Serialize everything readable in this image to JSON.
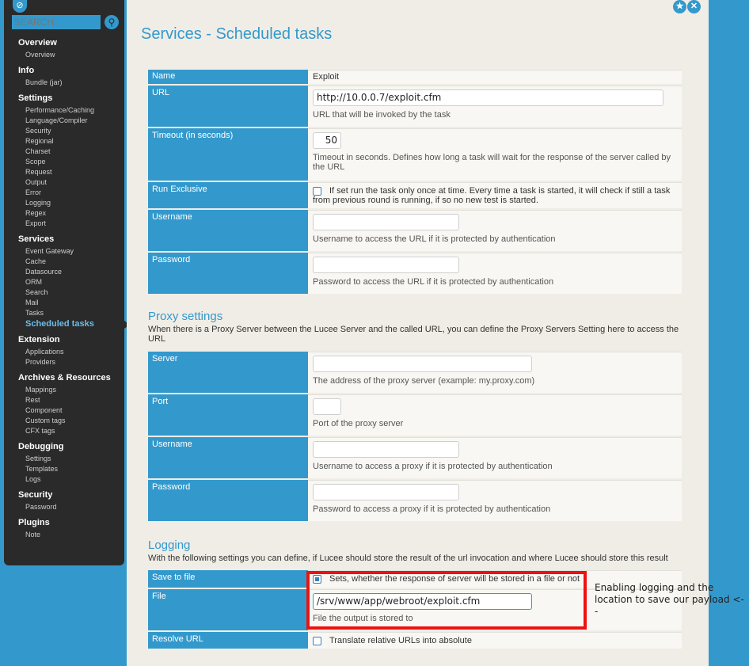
{
  "sidebar": {
    "search_placeholder": "SEARCH",
    "groups": [
      {
        "title": "Overview",
        "items": [
          "Overview"
        ]
      },
      {
        "title": "Info",
        "items": [
          "Bundle (jar)"
        ]
      },
      {
        "title": "Settings",
        "items": [
          "Performance/Caching",
          "Language/Compiler",
          "Security",
          "Regional",
          "Charset",
          "Scope",
          "Request",
          "Output",
          "Error",
          "Logging",
          "Regex",
          "Export"
        ]
      },
      {
        "title": "Services",
        "items": [
          "Event Gateway",
          "Cache",
          "Datasource",
          "ORM",
          "Search",
          "Mail",
          "Tasks",
          "Scheduled tasks"
        ]
      },
      {
        "title": "Extension",
        "items": [
          "Applications",
          "Providers"
        ]
      },
      {
        "title": "Archives & Resources",
        "items": [
          "Mappings",
          "Rest",
          "Component",
          "Custom tags",
          "CFX tags"
        ]
      },
      {
        "title": "Debugging",
        "items": [
          "Settings",
          "Templates",
          "Logs"
        ]
      },
      {
        "title": "Security",
        "items": [
          "Password"
        ]
      },
      {
        "title": "Plugins",
        "items": [
          "Note"
        ]
      }
    ],
    "active_item": "Scheduled tasks"
  },
  "page": {
    "title": "Services - Scheduled tasks"
  },
  "task": {
    "name_label": "Name",
    "name_value": "Exploit",
    "url_label": "URL",
    "url_value": "http://10.0.0.7/exploit.cfm",
    "url_hint": "URL that will be invoked by the task",
    "timeout_label": "Timeout (in seconds)",
    "timeout_value": "50",
    "timeout_hint": "Timeout in seconds. Defines how long a task will wait for the response of the server called by the URL",
    "exclusive_label": "Run Exclusive",
    "exclusive_hint": "If set run the task only once at time. Every time a task is started, it will check if still a task from previous round is running, if so no new test is started.",
    "username_label": "Username",
    "username_hint": "Username to access the URL if it is protected by authentication",
    "password_label": "Password",
    "password_hint": "Password to access the URL if it is protected by authentication"
  },
  "proxy": {
    "title": "Proxy settings",
    "description": "When there is a Proxy Server between the Lucee Server and the called URL, you can define the Proxy Servers Setting here to access the URL",
    "server_label": "Server",
    "server_hint": "The address of the proxy server (example: my.proxy.com)",
    "port_label": "Port",
    "port_hint": "Port of the proxy server",
    "username_label": "Username",
    "username_hint": "Username to access a proxy if it is protected by authentication",
    "password_label": "Password",
    "password_hint": "Password to access a proxy if it is protected by authentication"
  },
  "logging": {
    "title": "Logging",
    "description": "With the following settings you can define, if Lucee should store the result of the url invocation and where Lucee should store this result",
    "save_label": "Save to file",
    "save_hint": "Sets, whether the response of server will be stored in a file or not",
    "save_checked": true,
    "file_label": "File",
    "file_value": "/srv/www/app/webroot/exploit.cfm",
    "file_hint": "File the output is stored to",
    "resolve_label": "Resolve URL",
    "resolve_hint": "Translate relative URLs into absolute"
  },
  "annotation": {
    "text": "Enabling logging and the location to save our payload <--",
    "color": "#ee1111"
  }
}
